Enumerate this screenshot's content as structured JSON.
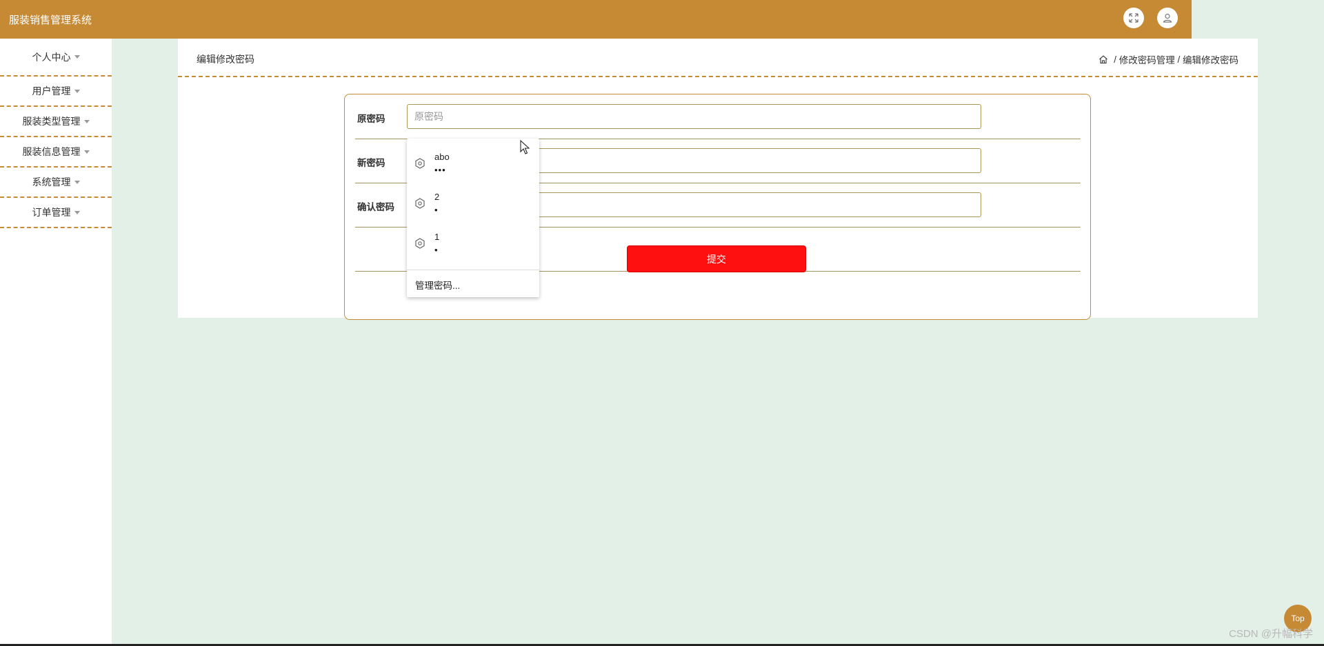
{
  "app": {
    "title": "服装销售管理系统"
  },
  "header_icons": [
    "fullscreen-icon",
    "user-icon"
  ],
  "sidebar": {
    "items": [
      {
        "label": "个人中心"
      },
      {
        "label": "用户管理"
      },
      {
        "label": "服装类型管理"
      },
      {
        "label": "服装信息管理"
      },
      {
        "label": "系统管理"
      },
      {
        "label": "订单管理"
      }
    ]
  },
  "panel": {
    "title": "编辑修改密码",
    "breadcrumb": [
      {
        "label": "修改密码管理"
      },
      {
        "label": "编辑修改密码"
      }
    ]
  },
  "form": {
    "fields": [
      {
        "label": "原密码",
        "placeholder": "原密码",
        "value": ""
      },
      {
        "label": "新密码",
        "placeholder": "",
        "value": ""
      },
      {
        "label": "确认密码",
        "placeholder": "",
        "value": ""
      }
    ],
    "submit_label": "提交"
  },
  "autofill": {
    "entries": [
      {
        "username": "abo",
        "mask": "•••"
      },
      {
        "username": "2",
        "mask": "•"
      },
      {
        "username": "1",
        "mask": "•"
      }
    ],
    "manage_label": "管理密码..."
  },
  "top_button": {
    "label": "Top"
  },
  "watermark": "CSDN @升幅科学",
  "colors": {
    "accent": "#c68a35",
    "submit": "#ff1010",
    "background": "#e3f0e8"
  }
}
